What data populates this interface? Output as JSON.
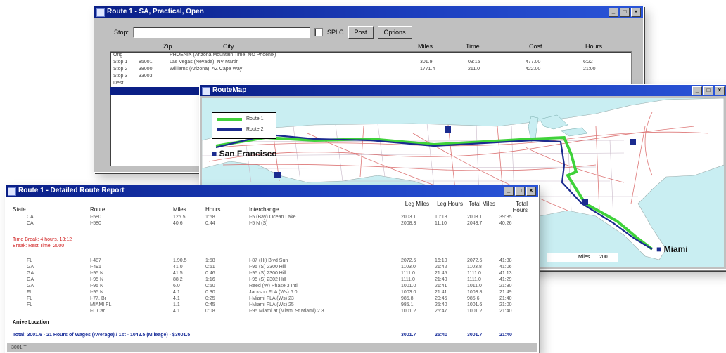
{
  "route_window": {
    "title": "Route 1 - SA, Practical, Open",
    "stop_label": "Stop:",
    "stop_value": "",
    "split_label": "SPLC",
    "buttons": [
      "Post",
      "Options"
    ],
    "columns": [
      "Zip",
      "City",
      "Miles",
      "Time",
      "Cost",
      "Hours"
    ],
    "rows": [
      {
        "label": "Orig",
        "zip": "",
        "city": "PHOENIX (Arizona Mountain Time, NO Phoenix)",
        "miles": "",
        "time": "",
        "cost": "",
        "hours": ""
      },
      {
        "label": "Stop 1",
        "zip": "85001",
        "city": "Las Vegas (Nevada), NV Martin",
        "miles": "301.9",
        "time": "03:15",
        "cost": "477.00",
        "hours": "6:22"
      },
      {
        "label": "Stop 2",
        "zip": "38000",
        "city": "Williams (Arizona), AZ Cape Way",
        "miles": "1771.4",
        "time": "211.0",
        "cost": "422.00",
        "hours": "21:00"
      },
      {
        "label": "Stop 3",
        "zip": "33003",
        "city": "",
        "miles": "",
        "time": "",
        "cost": "",
        "hours": ""
      },
      {
        "label": "Dest",
        "zip": "",
        "city": "",
        "miles": "",
        "time": "",
        "cost": "",
        "hours": ""
      }
    ]
  },
  "map_window": {
    "title": "RouteMap",
    "legend": [
      "Route 1",
      "Route 2"
    ],
    "colors": {
      "route1": "#3fd23a",
      "route2": "#1b2b8f",
      "water": "#c9eef2",
      "land": "#ffffff",
      "roads": "#d86060"
    },
    "origin_label": "San Francisco",
    "dest_label": "Miami",
    "scale_label": "Miles",
    "scale_value": "200"
  },
  "report_window": {
    "title": "Route 1 - Detailed Route Report",
    "headers": [
      "State",
      "Route",
      "Miles",
      "Hours",
      "Interchange",
      "Leg Miles",
      "Leg Hours",
      "Total Miles",
      "Total Hours"
    ],
    "rows_top": [
      [
        "CA",
        "I-580",
        "126.5",
        "1:58",
        "I-5 (Bay) Ocean Lake",
        "2003.1",
        "10:18",
        "2003.1",
        "39:35"
      ],
      [
        "CA",
        "I-580",
        "40.6",
        "0:44",
        "I-5 N (S)",
        "2008.3",
        "11:10",
        "2043.7",
        "40:26"
      ]
    ],
    "red_notes": [
      "Time Break: 4 hours, 13:12",
      "Break: Rest Time: 2000"
    ],
    "rows_bottom": [
      [
        "FL",
        "I-487",
        "1.90.5",
        "1:58",
        "I-87 (Hi) Blvd Sun",
        "2072.5",
        "16:10",
        "2072.5",
        "41:38"
      ],
      [
        "GA",
        "I-491",
        "41.0",
        "0:51",
        "I-95 (S) 2300 Hill",
        "1103.0",
        "21:42",
        "1103.8",
        "41:06"
      ],
      [
        "GA",
        "I-95 N",
        "41.5",
        "0:46",
        "I-95 (S) 2300 Hill",
        "1111.0",
        "21:45",
        "1111.0",
        "41:13"
      ],
      [
        "GA",
        "I-95 N",
        "88.2",
        "1:16",
        "I-95 (S) 2302 Hill",
        "1111.0",
        "21:40",
        "1111.0",
        "41:29"
      ],
      [
        "GA",
        "I-95 N",
        "6.0",
        "0:50",
        "Reed (W) Phase 3 Intl",
        "1001.0",
        "21:41",
        "1011.0",
        "21:30"
      ],
      [
        "FL",
        "I-95 N",
        "4.1",
        "0:30",
        "Jackson FLA (Ws) 6.0",
        "1003.0",
        "21:41",
        "1003.8",
        "21:49"
      ],
      [
        "FL",
        "I-77, Br",
        "4.1",
        "0:25",
        "I-Miami FLA (Ws) 23",
        "985.8",
        "20:45",
        "985.6",
        "21:40"
      ],
      [
        "FL",
        "MIAMI FL",
        "1.1",
        "0:45",
        "I-Miami FLA (Ws) 25",
        "985.1",
        "25:40",
        "1001.6",
        "21:00"
      ],
      [
        "",
        "FL Car",
        "4.1",
        "0:08",
        "I-95 Miami at (Miami St Miami) 2.3",
        "1001.2",
        "25:47",
        "1001.2",
        "21:40"
      ]
    ],
    "arrive_label": "Arrive Location",
    "summary": "Total: 3001.6 - 21 Hours of Wages (Average) / 1st - 1042.5 (Mileage) - $3001.5",
    "summary_values": [
      "3001.7",
      "25:40",
      "3001.7",
      "21:40"
    ],
    "status": "3001 T"
  }
}
